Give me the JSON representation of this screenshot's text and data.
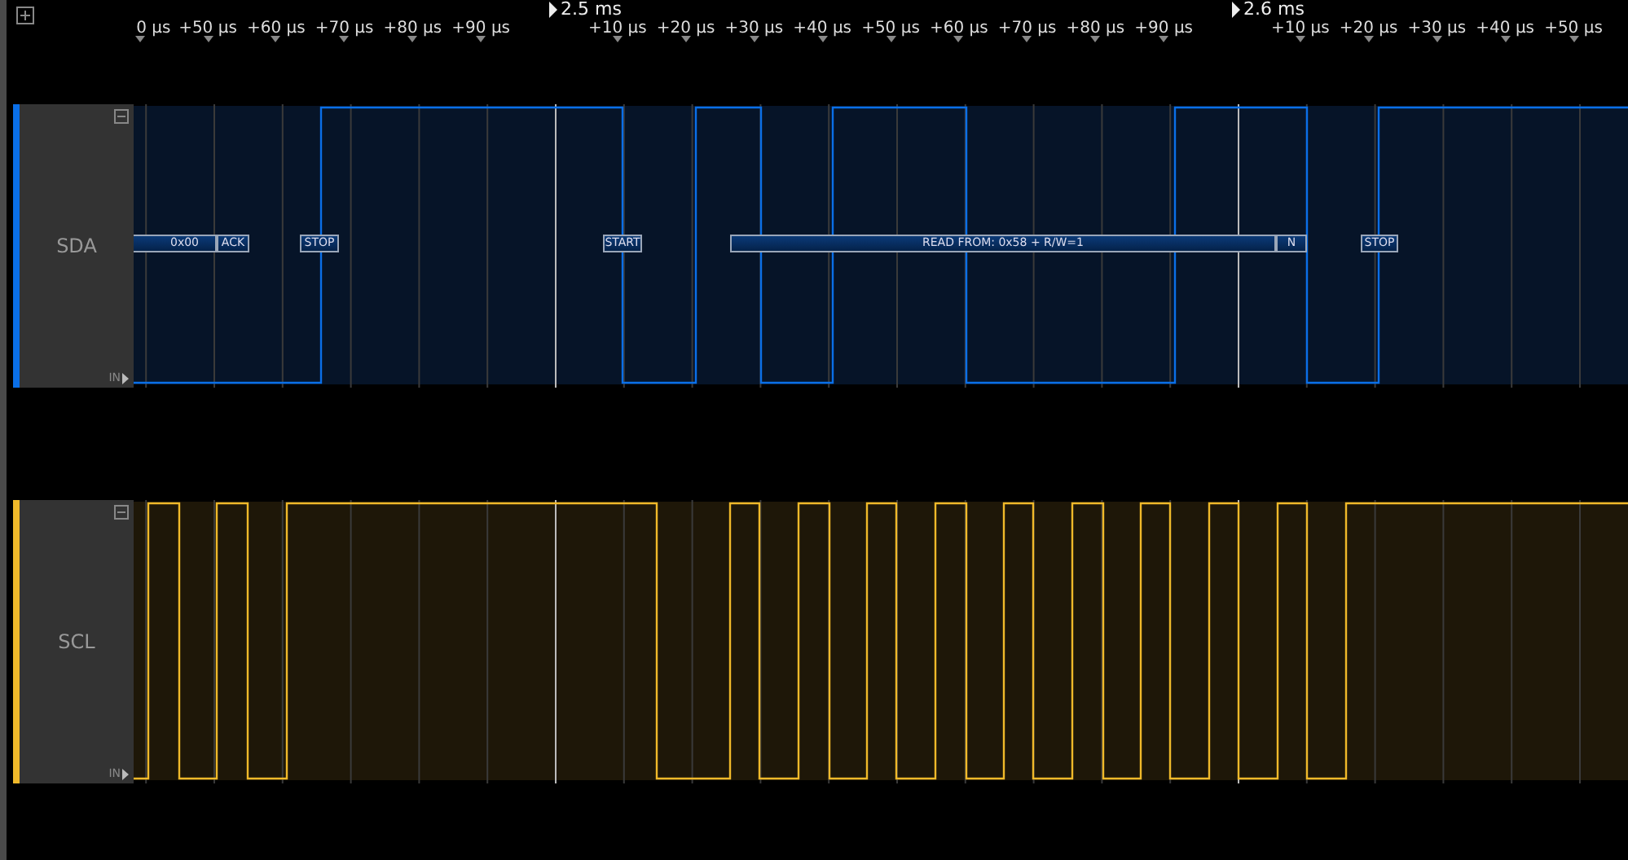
{
  "timeline": {
    "markers": [
      {
        "label": "2.5 ms"
      },
      {
        "label": "2.6 ms"
      }
    ],
    "ticks": [
      {
        "label": "0 µs"
      },
      {
        "label": "+50 µs"
      },
      {
        "label": "+60 µs"
      },
      {
        "label": "+70 µs"
      },
      {
        "label": "+80 µs"
      },
      {
        "label": "+90 µs"
      },
      {
        "label": "+10 µs"
      },
      {
        "label": "+20 µs"
      },
      {
        "label": "+30 µs"
      },
      {
        "label": "+40 µs"
      },
      {
        "label": "+50 µs"
      },
      {
        "label": "+60 µs"
      },
      {
        "label": "+70 µs"
      },
      {
        "label": "+80 µs"
      },
      {
        "label": "+90 µs"
      },
      {
        "label": "+10 µs"
      },
      {
        "label": "+20 µs"
      },
      {
        "label": "+30 µs"
      },
      {
        "label": "+40 µs"
      },
      {
        "label": "+50 µs"
      }
    ]
  },
  "channels": [
    {
      "name": "SDA",
      "color": "#0a6fe8",
      "input": "IN",
      "annotations": [
        "0x00",
        "ACK",
        "STOP",
        "START",
        "READ FROM: 0x58 + R/W=1",
        "N",
        "STOP"
      ]
    },
    {
      "name": "SCL",
      "color": "#f0b92a",
      "input": "IN"
    }
  ]
}
